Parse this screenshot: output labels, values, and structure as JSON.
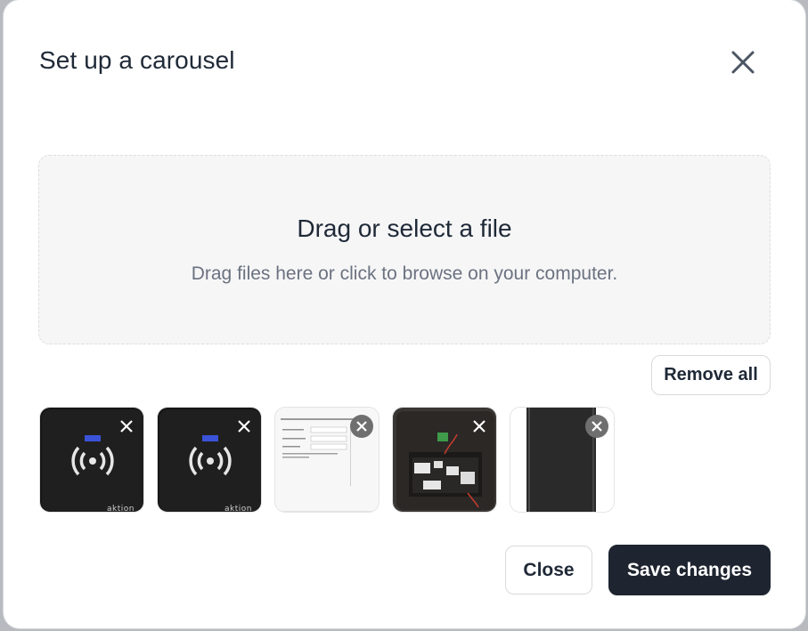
{
  "dialog": {
    "title": "Set up a carousel",
    "close_icon": "close-icon"
  },
  "dropzone": {
    "title": "Drag or select a file",
    "subtitle": "Drag files here or click to browse on your computer."
  },
  "actions": {
    "remove_all": "Remove all",
    "close": "Close",
    "save": "Save changes"
  },
  "thumbnails": [
    {
      "kind": "card-reader",
      "brand": "aktion",
      "remove_style": "plain-x"
    },
    {
      "kind": "card-reader",
      "brand": "aktion",
      "remove_style": "plain-x"
    },
    {
      "kind": "document-screenshot",
      "remove_style": "circle-x"
    },
    {
      "kind": "electronics-box",
      "remove_style": "plain-x"
    },
    {
      "kind": "dark-panel",
      "remove_style": "circle-x"
    }
  ],
  "colors": {
    "primary_button": "#1e2530",
    "text": "#1f2937",
    "muted_text": "#6b7280",
    "dropzone_bg": "#f6f6f7"
  }
}
